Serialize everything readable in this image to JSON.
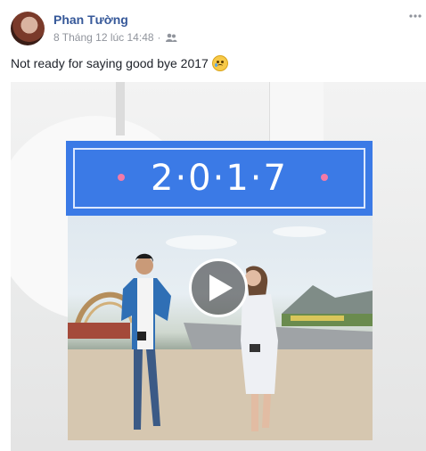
{
  "post": {
    "author": "Phan Tường",
    "timestamp": "8 Tháng 12 lúc 14:48",
    "separator": "·",
    "privacy_icon": "friends-icon",
    "more_icon": "more-options-icon",
    "text": "Not ready for saying good bye 2017",
    "emoji": "crying-face-emoji"
  },
  "media": {
    "banner_text": "2·0·1·7",
    "banner_color": "#3b7ae6",
    "play_icon": "play-icon"
  },
  "colors": {
    "author_link": "#365899",
    "meta_gray": "#90949c",
    "body_text": "#1d2129"
  }
}
